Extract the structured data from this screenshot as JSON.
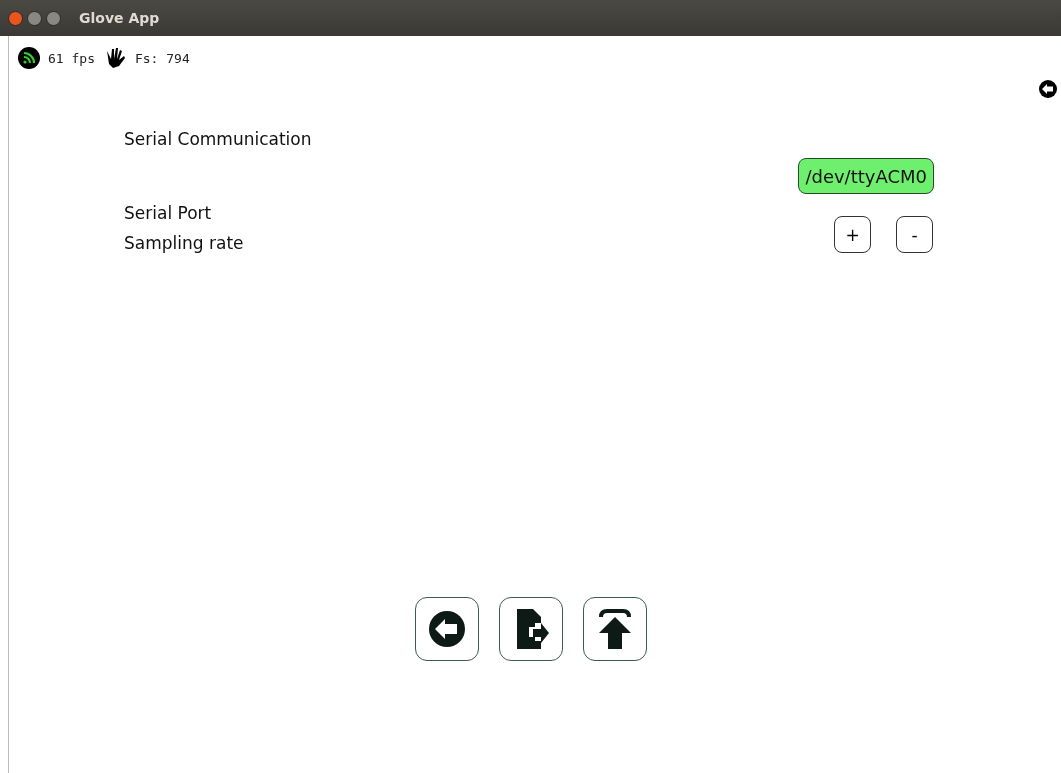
{
  "window": {
    "title": "Glove App"
  },
  "status_bar": {
    "fps": "61 fps",
    "sampling": "Fs: 794",
    "connected": true
  },
  "section_title": "Serial Communication",
  "serial_port": {
    "label": "Serial Port",
    "value": "/dev/ttyACM0",
    "connected": true
  },
  "sampling_rate": {
    "label": "Sampling rate",
    "increase": "+",
    "decrease": "-"
  }
}
